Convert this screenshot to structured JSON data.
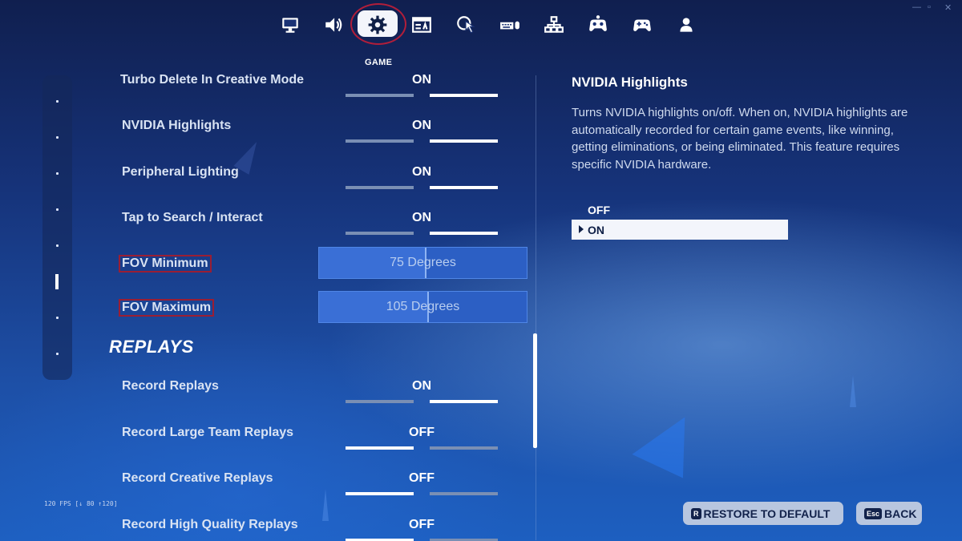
{
  "window_controls": [
    "—",
    "▫",
    "✕"
  ],
  "nav": {
    "tabs": [
      {
        "icon": "monitor-icon",
        "name": "tab-display"
      },
      {
        "icon": "speaker-icon",
        "name": "tab-audio"
      },
      {
        "icon": "gear-icon",
        "name": "tab-game",
        "active": true
      },
      {
        "icon": "accessibility-icon",
        "name": "tab-accessibility"
      },
      {
        "icon": "touch-icon",
        "name": "tab-touch"
      },
      {
        "icon": "keyboard-mouse-icon",
        "name": "tab-input"
      },
      {
        "icon": "network-icon",
        "name": "tab-network"
      },
      {
        "icon": "controller-settings-icon",
        "name": "tab-controller-settings"
      },
      {
        "icon": "gamepad-icon",
        "name": "tab-controller"
      },
      {
        "icon": "account-icon",
        "name": "tab-account"
      }
    ],
    "active_label": "GAME"
  },
  "settings": {
    "rows": [
      {
        "label": "Turbo Delete In Creative Mode",
        "value": "ON",
        "on": true
      },
      {
        "label": "NVIDIA Highlights",
        "value": "ON",
        "on": true
      },
      {
        "label": "Peripheral Lighting",
        "value": "ON",
        "on": true
      },
      {
        "label": "Tap to Search / Interact",
        "value": "ON",
        "on": true
      }
    ],
    "sliders": [
      {
        "label": "FOV Minimum",
        "value": "75 Degrees",
        "fraction": 0.51
      },
      {
        "label": "FOV Maximum",
        "value": "105 Degrees",
        "fraction": 0.52
      }
    ],
    "replays_title": "REPLAYS",
    "replay_rows": [
      {
        "label": "Record Replays",
        "value": "ON",
        "on": true
      },
      {
        "label": "Record Large Team Replays",
        "value": "OFF",
        "on": false
      },
      {
        "label": "Record Creative Replays",
        "value": "OFF",
        "on": false
      },
      {
        "label": "Record High Quality Replays",
        "value": "OFF",
        "on": false
      }
    ]
  },
  "help": {
    "title": "NVIDIA Highlights",
    "description": "Turns NVIDIA highlights on/off. When on, NVIDIA highlights are automatically recorded for certain game events, like winning, getting eliminations, or being eliminated. This feature requires specific NVIDIA hardware.",
    "options": [
      "OFF",
      "ON"
    ],
    "selected": "ON"
  },
  "fps_readout": "120 FPS [↓ 80 ↑120]",
  "buttons": {
    "restore_key": "R",
    "restore_label": "RESTORE TO DEFAULT",
    "back_key": "Esc",
    "back_label": "BACK"
  }
}
